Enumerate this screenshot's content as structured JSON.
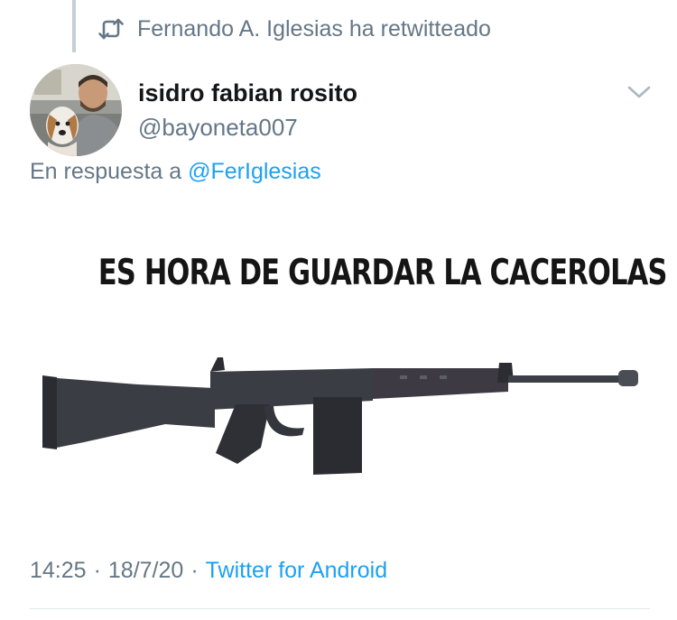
{
  "retweet_header": {
    "icon": "retweet-icon",
    "text": "Fernando A. Iglesias ha retwitteado"
  },
  "tweet": {
    "author": {
      "name": "isidro fabian rosito",
      "handle": "@bayoneta007",
      "avatar": "avatar-image"
    },
    "menu_icon": "chevron-down-icon",
    "reply": {
      "prefix": "En respuesta a",
      "mention": "@FerIglesias"
    },
    "media": {
      "caption": "ES HORA DE GUARDAR LA CACEROLAS",
      "image": "rifle-image"
    },
    "meta": {
      "time": "14:25",
      "separator1": "·",
      "date": "18/7/20",
      "separator2": "·",
      "source": "Twitter for Android"
    }
  },
  "colors": {
    "text_primary": "#14171a",
    "text_secondary": "#657786",
    "link": "#1da1f2",
    "divider": "#e1e8ed"
  }
}
